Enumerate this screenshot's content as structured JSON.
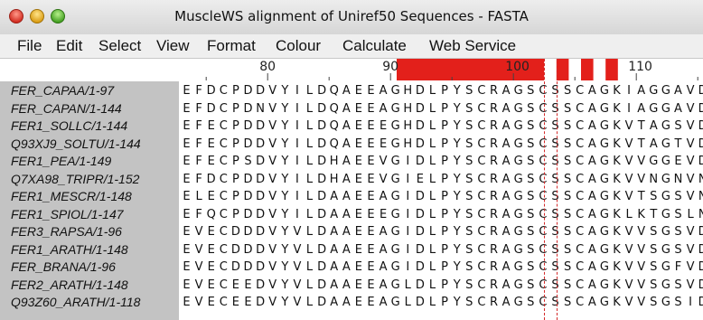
{
  "window": {
    "title": "MuscleWS alignment of Uniref50 Sequences - FASTA",
    "buttons": [
      "close",
      "minimize",
      "zoom"
    ]
  },
  "menu": [
    "File",
    "Edit",
    "Select",
    "View",
    "Format",
    "Colour",
    "Calculate",
    "Web Service"
  ],
  "ruler": {
    "labels": [
      "80",
      "90",
      "100",
      "110"
    ],
    "label_columns": [
      80,
      90,
      100,
      110
    ],
    "first_column": 1,
    "highlight_columns": [
      [
        91,
        102
      ],
      [
        104,
        104
      ],
      [
        106,
        106
      ],
      [
        108,
        108
      ]
    ],
    "highlight_color": "#e3201b"
  },
  "guides": [
    103,
    104
  ],
  "accent_color": "#d42a2a",
  "sequences": [
    {
      "name": "FER_CAPAA/1-97",
      "residues": "EFDCPDDVYILDQAEEAGHDLPYSCRAGSCSSCAGKIAGGAVDQT"
    },
    {
      "name": "FER_CAPAN/1-144",
      "residues": "EFDCPDNVYILDQAEEAGHDLPYSCRAGSCSSCAGKIAGGAVDQT"
    },
    {
      "name": "FER1_SOLLC/1-144",
      "residues": "EFECPDDVYILDQAEEEGHDLPYSCRAGSCSSCAGKVTAGSVDQS"
    },
    {
      "name": "Q93XJ9_SOLTU/1-144",
      "residues": "EFECPDDVYILDQAEEEGHDLPYSCRAGSCSSCAGKVTAGTVDQS"
    },
    {
      "name": "FER1_PEA/1-149",
      "residues": "EFECPSDVYILDHAEEVGIDLPYSCRAGSCSSCAGKVVGGEVDQS"
    },
    {
      "name": "Q7XA98_TRIPR/1-152",
      "residues": "EFDCPDDVYILDHAEEVGIELPYSCRAGSCSSCAGKVVNGNVNQE"
    },
    {
      "name": "FER1_MESCR/1-148",
      "residues": "ELECPDDVYILDAAEEAGIDLPYSCRAGSCSSCAGKVTSGSVNQD"
    },
    {
      "name": "FER1_SPIOL/1-147",
      "residues": "EFQCPDDVYILDAAEEEGIDLPYSCRAGSCSSCAGKLKTGSLNQD"
    },
    {
      "name": "FER3_RAPSA/1-96",
      "residues": "EVECDDDVYVLDAAEEAGIDLPYSCRAGSCSSCAGKVVSGSVDQS"
    },
    {
      "name": "FER1_ARATH/1-148",
      "residues": "EVECDDDVYVLDAAEEAGIDLPYSCRAGSCSSCAGKVVSGSVDQS"
    },
    {
      "name": "FER_BRANA/1-96",
      "residues": "EVECDDDVYVLDAAEEAGIDLPYSCRAGSCSSCAGKVVSGFVDQS"
    },
    {
      "name": "FER2_ARATH/1-148",
      "residues": "EVECEEDVYVLDAAEEAGLDLPYSCRAGSCSSCAGKVVSGSVDQS"
    },
    {
      "name": "Q93Z60_ARATH/1-118",
      "residues": "EVECEEDVYVLDAAEEAGLDLPYSCRAGSCSSCAGKVVSGSIDQS"
    }
  ]
}
